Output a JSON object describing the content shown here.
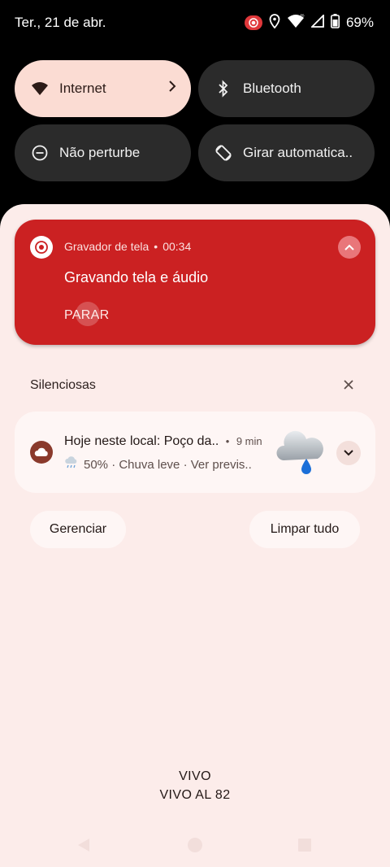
{
  "status_bar": {
    "date": "Ter., 21 de abr.",
    "battery": "69%",
    "icons": [
      "screen-record-icon",
      "location-icon",
      "wifi-icon",
      "signal-icon",
      "battery-icon"
    ]
  },
  "quick_tiles": [
    {
      "label": "Internet",
      "icon": "wifi-icon",
      "active": true,
      "has_chevron": true
    },
    {
      "label": "Bluetooth",
      "icon": "bluetooth-icon",
      "active": false
    },
    {
      "label": "Não perturbe",
      "icon": "do-not-disturb-icon",
      "active": false
    },
    {
      "label": "Girar automatica..",
      "icon": "auto-rotate-icon",
      "active": false
    }
  ],
  "recorder_notification": {
    "app_name": "Gravador de tela",
    "separator": "•",
    "elapsed": "00:34",
    "title": "Gravando tela e áudio",
    "action": "PARAR",
    "color": "#cb2122"
  },
  "silent_section": {
    "title": "Silenciosas"
  },
  "weather_notification": {
    "title": "Hoje neste local: Poço da..",
    "separator": "•",
    "time": "9 min",
    "subtitle": "50% · Chuva leve · Ver previs..",
    "icon": "rain-cloud-icon"
  },
  "buttons": {
    "manage": "Gerenciar",
    "clear_all": "Limpar tudo"
  },
  "carrier": {
    "line1": "VIVO",
    "line2": "VIVO AL 82"
  }
}
